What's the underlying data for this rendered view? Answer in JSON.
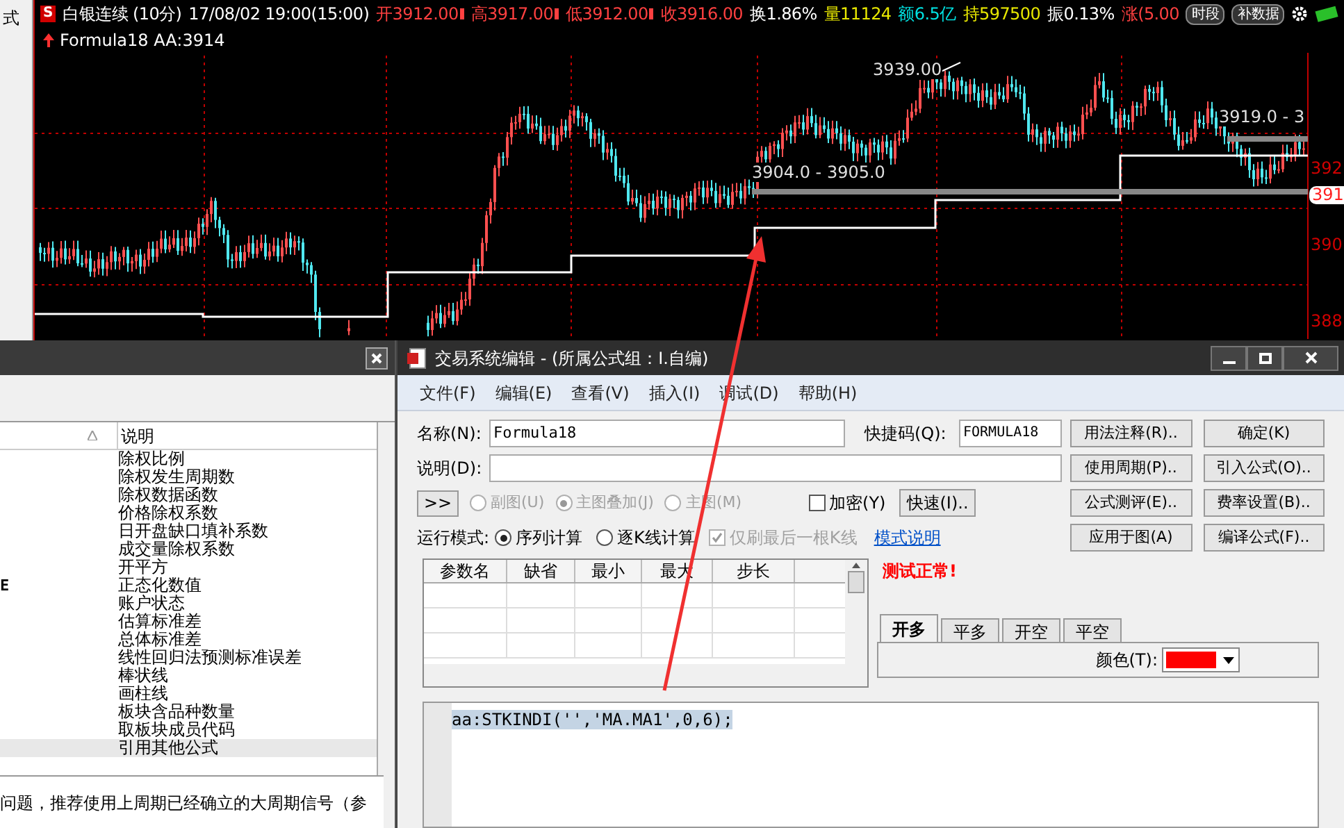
{
  "side_strip": {
    "text": "式"
  },
  "quote_bar": {
    "badge": "S",
    "items": [
      {
        "text": "白银连续 (10分)",
        "color": "#ffffff",
        "marker": false
      },
      {
        "text": "17/08/02 19:00(15:00)",
        "color": "#ffffff",
        "marker": false
      },
      {
        "text": "开3912.00",
        "color": "#ff4040",
        "marker": true
      },
      {
        "text": "高3917.00",
        "color": "#ff4040",
        "marker": true
      },
      {
        "text": "低3912.00",
        "color": "#ff4040",
        "marker": true
      },
      {
        "text": "收3916.00",
        "color": "#ff4040",
        "marker": false
      },
      {
        "text": "换1.86%",
        "color": "#ffffff",
        "marker": false
      },
      {
        "text": "量11124",
        "color": "#e8e800",
        "marker": false
      },
      {
        "text": "额6.5亿",
        "color": "#00e0e0",
        "marker": false
      },
      {
        "text": "持597500",
        "color": "#e8e800",
        "marker": false
      },
      {
        "text": "振0.13%",
        "color": "#ffffff",
        "marker": false
      },
      {
        "text": "涨(5.00",
        "color": "#ff4040",
        "marker": false
      }
    ],
    "buttons": [
      "时段",
      "补数据"
    ]
  },
  "indicator_line": {
    "text": "Formula18 AA:3914"
  },
  "chart": {
    "annotations": [
      {
        "text": "3939.00",
        "kind": "high"
      },
      {
        "text": "3904.0 - 3905.0",
        "kind": "band"
      },
      {
        "text": "3919.0 - 3",
        "kind": "band2"
      }
    ],
    "price_labels": [
      {
        "text": "392",
        "kind": "tick"
      },
      {
        "text": "391",
        "kind": "current"
      },
      {
        "text": "390",
        "kind": "tick"
      },
      {
        "text": "388",
        "kind": "tick"
      }
    ]
  },
  "function_window": {
    "header": "说明",
    "rows": [
      {
        "description": "除权比例",
        "selected": false
      },
      {
        "description": "除权发生周期数",
        "selected": false
      },
      {
        "description": "除权数据函数",
        "selected": false
      },
      {
        "description": "价格除权系数",
        "selected": false
      },
      {
        "description": "日开盘缺口填补系数",
        "selected": false
      },
      {
        "description": "成交量除权系数",
        "selected": false
      },
      {
        "description": "开平方",
        "selected": false
      },
      {
        "code": "E",
        "description": "正态化数值",
        "selected": false
      },
      {
        "description": "账户状态",
        "selected": false
      },
      {
        "description": "估算标准差",
        "selected": false
      },
      {
        "description": "总体标准差",
        "selected": false
      },
      {
        "description": "线性回归法预测标准误差",
        "selected": false
      },
      {
        "description": "棒状线",
        "selected": false
      },
      {
        "description": "画柱线",
        "selected": false
      },
      {
        "description": "板块含品种数量",
        "selected": false
      },
      {
        "description": "取板块成员代码",
        "selected": false
      },
      {
        "description": "引用其他公式",
        "selected": true
      }
    ],
    "help_text": "问题，推荐使用上周期已经确立的大周期信号（参"
  },
  "editor_window": {
    "title": "交易系统编辑 - (所属公式组：I.自编)",
    "menu": [
      "文件(F)",
      "编辑(E)",
      "查看(V)",
      "插入(I)",
      "调试(D)",
      "帮助(H)"
    ],
    "name_label": "名称(N):",
    "name_value": "Formula18",
    "shortcut_label": "快捷码(Q):",
    "shortcut_value": "FORMULA18",
    "desc_label": "说明(D):",
    "expand_button": ">>",
    "chart_modes": [
      {
        "label": "副图(U)",
        "selected": false,
        "disabled": true
      },
      {
        "label": "主图叠加(J)",
        "selected": true,
        "disabled": true
      },
      {
        "label": "主图(M)",
        "selected": false,
        "disabled": true
      }
    ],
    "encrypt": {
      "label": "加密(Y)",
      "checked": false
    },
    "quick_button": "快速(I)..",
    "run_mode_label": "运行模式:",
    "run_modes": [
      {
        "label": "序列计算",
        "selected": true
      },
      {
        "label": "逐K线计算",
        "selected": false
      }
    ],
    "refresh_last": {
      "label": "仅刷最后一根K线",
      "checked": true,
      "disabled": true
    },
    "mode_link": "模式说明",
    "side_buttons": [
      "用法注释(R)..",
      "确定(K)",
      "使用周期(P)..",
      "引入公式(O)..",
      "公式测评(E)..",
      "费率设置(B)..",
      "应用于图(A)",
      "编译公式(F).."
    ],
    "param_columns": [
      "参数名",
      "缺省",
      "最小",
      "最大",
      "步长"
    ],
    "status": "测试正常!",
    "signal_tabs": [
      {
        "label": "开多",
        "selected": true
      },
      {
        "label": "平多",
        "selected": false
      },
      {
        "label": "开空",
        "selected": false
      },
      {
        "label": "平空",
        "selected": false
      }
    ],
    "color_label": "颜色(T):",
    "color": "#ff0000",
    "code": "aa:STKINDI('','MA.MA1',0,6);"
  }
}
